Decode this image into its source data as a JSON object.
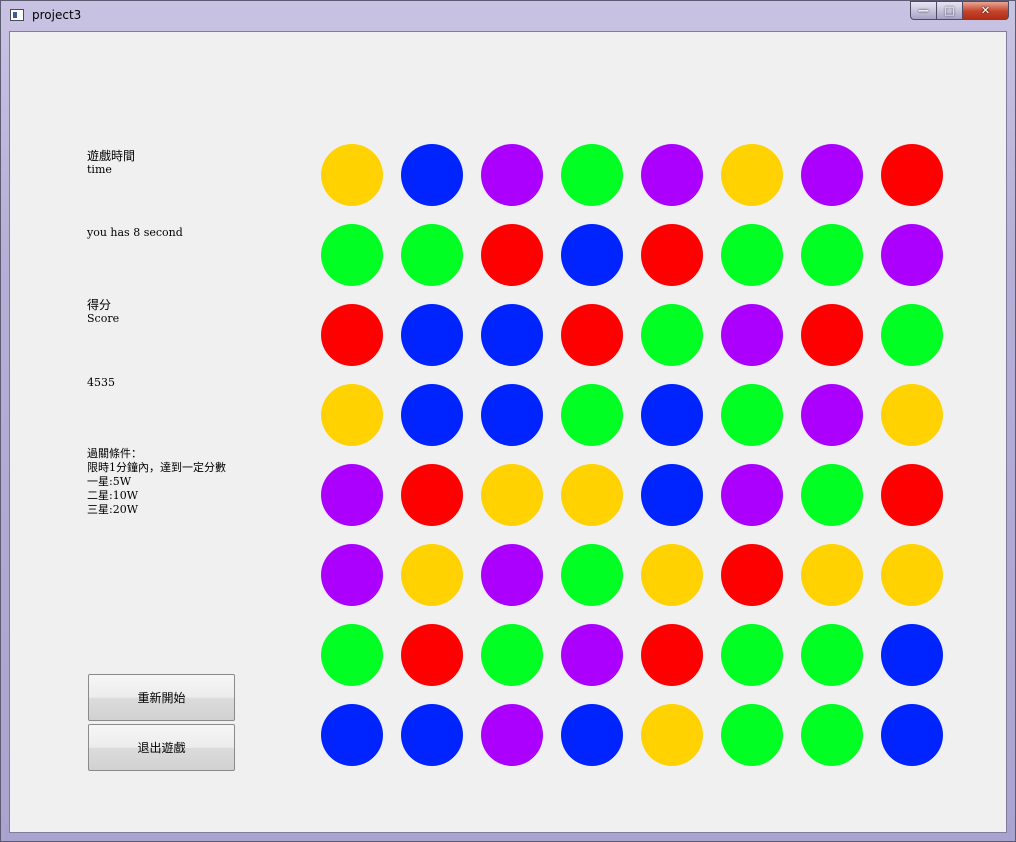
{
  "window": {
    "title": "project3",
    "controls": {
      "minimize": "—",
      "maximize": "□",
      "close": "✕"
    }
  },
  "panel": {
    "time_label_cn": "遊戲時間",
    "time_label_en": "time",
    "time_remaining": "you has 8 second",
    "score_label_cn": "得分",
    "score_label_en": "Score",
    "score_value": "4535",
    "conditions": [
      "過關條件：",
      "限時1分鐘內，達到一定分數",
      "一星:5W",
      "二星:10W",
      "三星:20W"
    ]
  },
  "buttons": {
    "restart": "重新開始",
    "quit": "退出遊戲"
  },
  "colors": {
    "yellow": "#ffd200",
    "blue": "#0024ff",
    "purple": "#ac00ff",
    "green": "#00ff22",
    "red": "#ff0000"
  },
  "board": [
    [
      "yellow",
      "blue",
      "purple",
      "green",
      "purple",
      "yellow",
      "purple",
      "red"
    ],
    [
      "green",
      "green",
      "red",
      "blue",
      "red",
      "green",
      "green",
      "purple"
    ],
    [
      "red",
      "blue",
      "blue",
      "red",
      "green",
      "purple",
      "red",
      "green"
    ],
    [
      "yellow",
      "blue",
      "blue",
      "green",
      "blue",
      "green",
      "purple",
      "yellow"
    ],
    [
      "purple",
      "red",
      "yellow",
      "yellow",
      "blue",
      "purple",
      "green",
      "red"
    ],
    [
      "purple",
      "yellow",
      "purple",
      "green",
      "yellow",
      "red",
      "yellow",
      "yellow"
    ],
    [
      "green",
      "red",
      "green",
      "purple",
      "red",
      "green",
      "green",
      "blue"
    ],
    [
      "blue",
      "blue",
      "purple",
      "blue",
      "yellow",
      "green",
      "green",
      "blue"
    ]
  ]
}
